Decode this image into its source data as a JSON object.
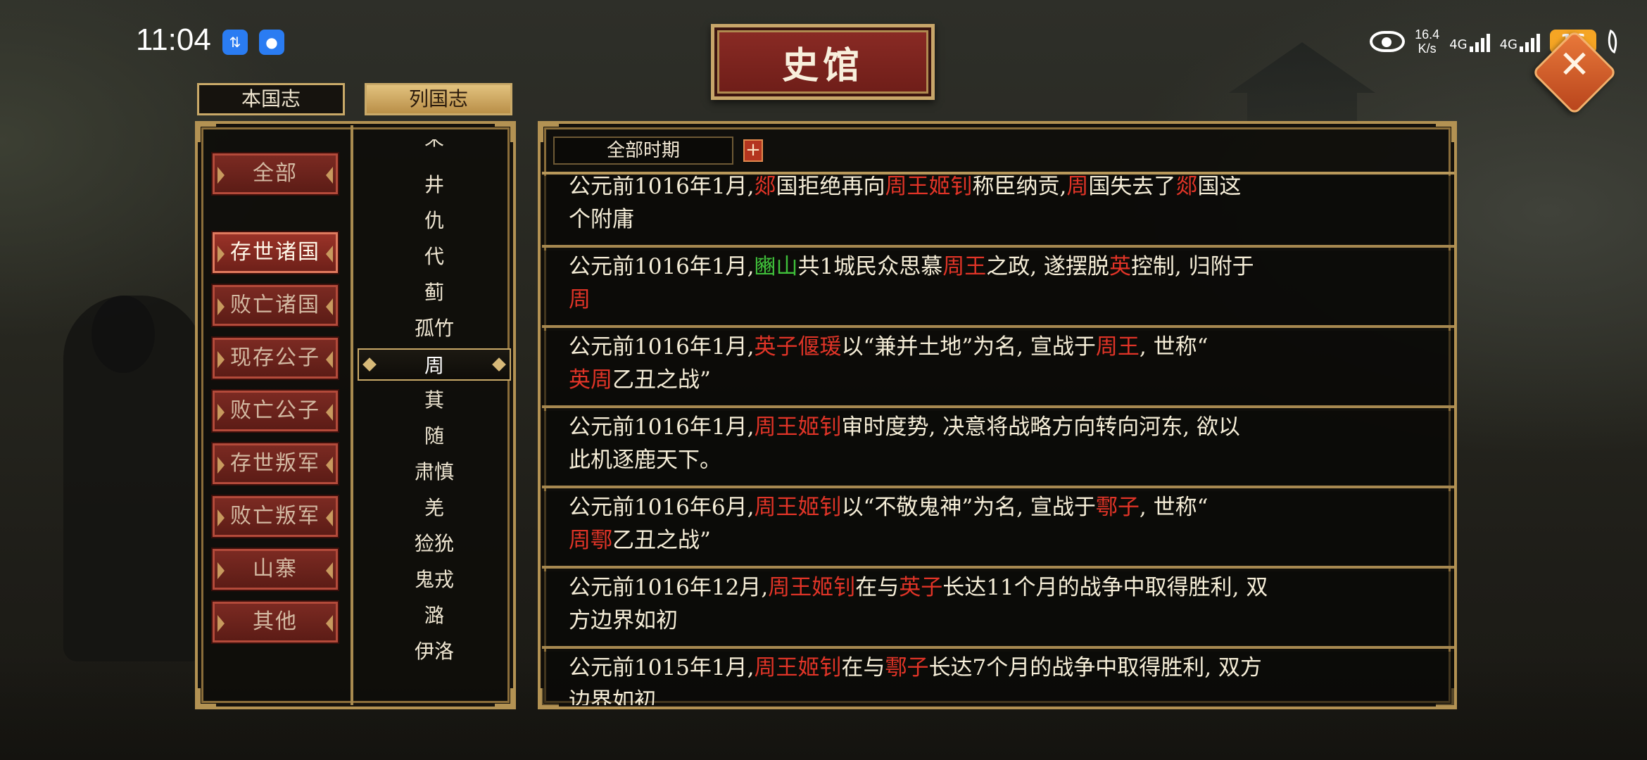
{
  "status_bar": {
    "time": "11:04",
    "net_speed_value": "16.4",
    "net_speed_unit": "K/s",
    "signal1_label": "4G",
    "signal2_label": "4G",
    "battery": "16"
  },
  "title": "史馆",
  "tabs": [
    {
      "label": "本国志",
      "active": false
    },
    {
      "label": "列国志",
      "active": true
    }
  ],
  "categories": [
    {
      "label": "全部",
      "active": false
    },
    {
      "label": "存世诸国",
      "active": true
    },
    {
      "label": "败亡诸国",
      "active": false
    },
    {
      "label": "现存公子",
      "active": false
    },
    {
      "label": "败亡公子",
      "active": false
    },
    {
      "label": "存世叛军",
      "active": false
    },
    {
      "label": "败亡叛军",
      "active": false
    },
    {
      "label": "山寨",
      "active": false
    },
    {
      "label": "其他",
      "active": false
    }
  ],
  "nations": [
    "荣",
    "井",
    "仇",
    "代",
    "蓟",
    "孤竹",
    "周",
    "萁",
    "随",
    "肃慎",
    "羌",
    "猃狁",
    "鬼戎",
    "潞",
    "伊洛"
  ],
  "selected_nation": "周",
  "period_filter": {
    "label": "全部时期",
    "plus": "+"
  },
  "entries": [
    {
      "l1": [
        [
          "公元前1016年1月,",
          ""
        ],
        [
          "郯",
          "r"
        ],
        [
          "国拒绝再向",
          ""
        ],
        [
          "周王姬钊",
          "r"
        ],
        [
          "称臣纳贡,",
          ""
        ],
        [
          "周",
          "r"
        ],
        [
          "国失去了",
          ""
        ],
        [
          "郯",
          "r"
        ],
        [
          "国这",
          ""
        ]
      ],
      "l2": [
        [
          "个附庸",
          ""
        ]
      ]
    },
    {
      "l1": [
        [
          "公元前1016年1月,",
          ""
        ],
        [
          "豳山",
          "g"
        ],
        [
          "共1城民众思慕",
          ""
        ],
        [
          "周王",
          "r"
        ],
        [
          "之政, 遂摆脱",
          ""
        ],
        [
          "英",
          "r"
        ],
        [
          "控制, 归附于",
          ""
        ]
      ],
      "l2": [
        [
          "周",
          "r"
        ]
      ]
    },
    {
      "l1": [
        [
          "公元前1016年1月,",
          ""
        ],
        [
          "英子偃瑗",
          "r"
        ],
        [
          "以“兼并土地”为名, 宣战于",
          ""
        ],
        [
          "周王",
          "r"
        ],
        [
          ", 世称“",
          ""
        ]
      ],
      "l2": [
        [
          "英周",
          "r"
        ],
        [
          "乙丑之战”",
          ""
        ]
      ]
    },
    {
      "l1": [
        [
          "公元前1016年1月,",
          ""
        ],
        [
          "周王姬钊",
          "r"
        ],
        [
          "审时度势, 决意将战略方向转向河东, 欲以",
          ""
        ]
      ],
      "l2": [
        [
          "此机逐鹿天下。",
          ""
        ]
      ]
    },
    {
      "l1": [
        [
          "公元前1016年6月,",
          ""
        ],
        [
          "周王姬钊",
          "r"
        ],
        [
          "以“不敬鬼神”为名, 宣战于",
          ""
        ],
        [
          "鄠子",
          "r"
        ],
        [
          ", 世称“",
          ""
        ]
      ],
      "l2": [
        [
          "周鄠",
          "r"
        ],
        [
          "乙丑之战”",
          ""
        ]
      ]
    },
    {
      "l1": [
        [
          "公元前1016年12月,",
          ""
        ],
        [
          "周王姬钊",
          "r"
        ],
        [
          "在与",
          ""
        ],
        [
          "英子",
          "r"
        ],
        [
          "长达11个月的战争中取得胜利, 双",
          ""
        ]
      ],
      "l2": [
        [
          "方边界如初",
          ""
        ]
      ]
    },
    {
      "l1": [
        [
          "公元前1015年1月,",
          ""
        ],
        [
          "周王姬钊",
          "r"
        ],
        [
          "在与",
          ""
        ],
        [
          "鄠子",
          "r"
        ],
        [
          "长达7个月的战争中取得胜利, 双方",
          ""
        ]
      ],
      "l2": [
        [
          "边界如初",
          ""
        ]
      ]
    }
  ]
}
